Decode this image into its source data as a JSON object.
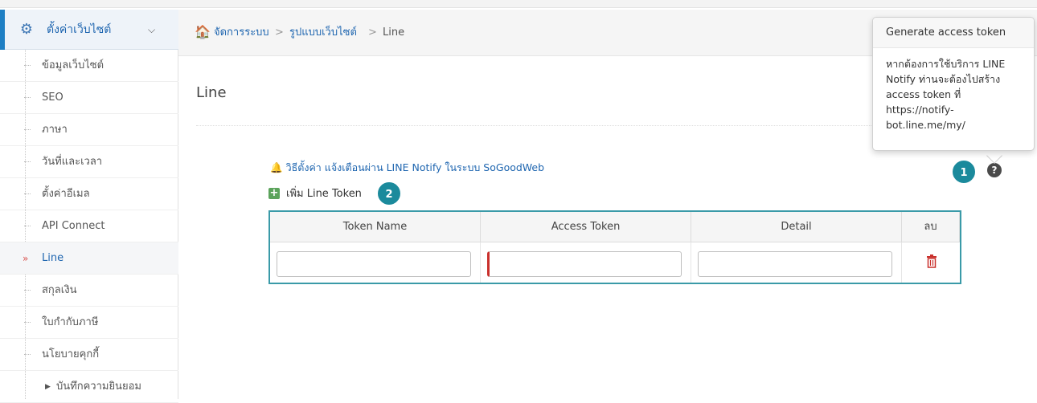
{
  "sidebar": {
    "header": {
      "label": "ตั้งค่าเว็บไซต์",
      "icon": "gear-icon",
      "chevron": "chevron-down-icon"
    },
    "items": [
      {
        "label": "ข้อมูลเว็บไซต์"
      },
      {
        "label": "SEO"
      },
      {
        "label": "ภาษา"
      },
      {
        "label": "วันที่และเวลา"
      },
      {
        "label": "ตั้งค่าอีเมล"
      },
      {
        "label": "API Connect"
      },
      {
        "label": "Line",
        "active": true
      },
      {
        "label": "สกุลเงิน"
      },
      {
        "label": "ใบกำกับภาษี"
      },
      {
        "label": "นโยบายคุกกี้"
      }
    ],
    "sub_item": {
      "label": "บันทึกความยินยอม"
    }
  },
  "breadcrumb": {
    "home_icon": "home-icon",
    "items": [
      "จัดการระบบ",
      "รูปแบบเว็บไซต์",
      "Line"
    ],
    "separator": ">"
  },
  "page": {
    "title": "Line",
    "notify_link": "วิธีตั้งค่า แจ้งเตือนผ่าน LINE Notify ในระบบ SoGoodWeb",
    "add_button": "เพิ่ม Line Token"
  },
  "table": {
    "columns": [
      "Token Name",
      "Access Token",
      "Detail",
      "ลบ"
    ],
    "rows": [
      {
        "token_name": "",
        "access_token": "",
        "detail": ""
      }
    ]
  },
  "popover": {
    "title": "Generate access token",
    "body": "หากต้องการใช้บริการ LINE Notify ท่านจะต้องไปสร้าง access token ที่ https://notify-bot.line.me/my/"
  },
  "badges": {
    "one": "1",
    "two": "2"
  },
  "help_icon": "?",
  "colors": {
    "accent": "#1f66b0",
    "table_border": "#3a9aa8",
    "badge": "#1b8a9c",
    "error": "#c9302c",
    "add": "#5ba35b"
  }
}
